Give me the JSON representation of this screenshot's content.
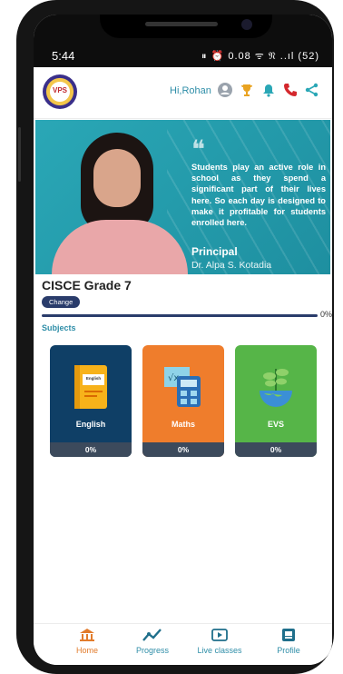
{
  "status_bar": {
    "time": "5:44",
    "icons_text": "⏸ ⏰ 0.08 ᯤ 𝔑 ..ıl (52)"
  },
  "header": {
    "logo_text": "VPS",
    "greeting": "Hi,Rohan",
    "icons": [
      "avatar-icon",
      "trophy-icon",
      "bell-icon",
      "phone-icon",
      "share-icon"
    ],
    "colors": {
      "trophy": "#e9a321",
      "bell": "#2aa7b6",
      "phone": "#d4282d",
      "share": "#2aa7b6"
    }
  },
  "banner": {
    "quote": "Students play an active role in school as they spend a significant part of their lives here. So each day is designed to make it profitable for students enrolled here.",
    "title": "Principal",
    "name": "Dr. Alpa S. Kotadia",
    "background": "#2aa7b6"
  },
  "course": {
    "grade_title": "CISCE Grade 7",
    "change_label": "Change",
    "progress": 0,
    "progress_label": "0%"
  },
  "subjects_heading": "Subjects",
  "subjects": [
    {
      "name": "English",
      "progress_label": "0%",
      "color": "#0f3f66",
      "book_label": "English"
    },
    {
      "name": "Maths",
      "progress_label": "0%",
      "color": "#ef7d2c"
    },
    {
      "name": "EVS",
      "progress_label": "0%",
      "color": "#56b548"
    }
  ],
  "bottom_nav": [
    {
      "label": "Home",
      "icon": "home-icon",
      "active": true
    },
    {
      "label": "Progress",
      "icon": "progress-icon",
      "active": false
    },
    {
      "label": "Live classes",
      "icon": "live-classes-icon",
      "active": false
    },
    {
      "label": "Profile",
      "icon": "profile-icon",
      "active": false
    }
  ]
}
